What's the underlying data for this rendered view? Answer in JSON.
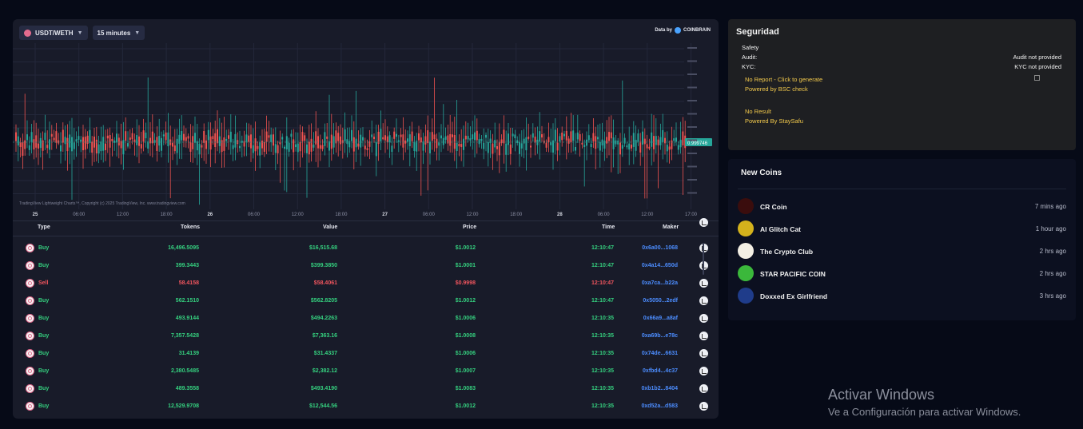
{
  "toolbar": {
    "pair": "USDT/WETH",
    "interval": "15 minutes",
    "data_by": "Data by",
    "provider": "COINBRAIN"
  },
  "chart_data": {
    "type": "candlestick",
    "last_price_label": "0.999746",
    "xticks": [
      "25",
      "06:00",
      "12:00",
      "18:00",
      "26",
      "06:00",
      "12:00",
      "18:00",
      "27",
      "06:00",
      "12:00",
      "18:00",
      "28",
      "06:00",
      "12:00",
      "17:00"
    ],
    "credit": "TradingView Lightweight Charts™, Copyright (c) 2025 TradingView, Inc. www.tradingview.com",
    "colors": {
      "up": "#26a69a",
      "down": "#ef5350",
      "grid": "#23273a",
      "price_tag": "#26a69a"
    }
  },
  "trades": {
    "headers": {
      "type": "Type",
      "tokens": "Tokens",
      "value": "Value",
      "price": "Price",
      "time": "Time",
      "maker": "Maker"
    },
    "rows": [
      {
        "type": "Buy",
        "tokens": "16,496.5095",
        "value": "$16,515.68",
        "price": "$1.0012",
        "time": "12:10:47",
        "maker": "0x6a00...1068"
      },
      {
        "type": "Buy",
        "tokens": "399.3443",
        "value": "$399.3850",
        "price": "$1.0001",
        "time": "12:10:47",
        "maker": "0x4a14...650d"
      },
      {
        "type": "Sell",
        "tokens": "58.4158",
        "value": "$58.4061",
        "price": "$0.9998",
        "time": "12:10:47",
        "maker": "0xa7ca...b22a"
      },
      {
        "type": "Buy",
        "tokens": "562.1510",
        "value": "$562.8205",
        "price": "$1.0012",
        "time": "12:10:47",
        "maker": "0x5050...2edf"
      },
      {
        "type": "Buy",
        "tokens": "493.9144",
        "value": "$494.2263",
        "price": "$1.0006",
        "time": "12:10:35",
        "maker": "0x66a9...a8af"
      },
      {
        "type": "Buy",
        "tokens": "7,357.5428",
        "value": "$7,363.16",
        "price": "$1.0008",
        "time": "12:10:35",
        "maker": "0xa69b...e78c"
      },
      {
        "type": "Buy",
        "tokens": "31.4139",
        "value": "$31.4337",
        "price": "$1.0006",
        "time": "12:10:35",
        "maker": "0x74de...6631"
      },
      {
        "type": "Buy",
        "tokens": "2,380.5485",
        "value": "$2,382.12",
        "price": "$1.0007",
        "time": "12:10:35",
        "maker": "0xfbd4...4c37"
      },
      {
        "type": "Buy",
        "tokens": "489.3558",
        "value": "$493.4190",
        "price": "$1.0083",
        "time": "12:10:35",
        "maker": "0xb1b2...8404"
      },
      {
        "type": "Buy",
        "tokens": "12,529.9708",
        "value": "$12,544.56",
        "price": "$1.0012",
        "time": "12:10:35",
        "maker": "0xd52a...d583"
      }
    ]
  },
  "security": {
    "title": "Seguridad",
    "safety_label": "Safety",
    "audit_label": "Audit:",
    "audit_value": "Audit not provided",
    "kyc_label": "KYC:",
    "kyc_value": "KYC not provided",
    "report_link": "No Report - Click to generate",
    "report_powered": "Powered by BSC check",
    "result_text": "No Result",
    "result_powered": "Powered By StaySafu"
  },
  "new_coins": {
    "title": "New Coins",
    "items": [
      {
        "name": "CR Coin",
        "time": "7 mins ago",
        "color": "#3a0d0d"
      },
      {
        "name": "AI Glitch Cat",
        "time": "1 hour ago",
        "color": "#d4b21c"
      },
      {
        "name": "The Crypto Club",
        "time": "2 hrs ago",
        "color": "#f3efe4"
      },
      {
        "name": "STAR PACIFIC COIN",
        "time": "2 hrs ago",
        "color": "#3bb83b"
      },
      {
        "name": "Doxxed Ex Girlfriend",
        "time": "3 hrs ago",
        "color": "#1f3c8a"
      }
    ]
  },
  "os_watermark": {
    "line1": "Activar Windows",
    "line2": "Ve a Configuración para activar Windows."
  }
}
